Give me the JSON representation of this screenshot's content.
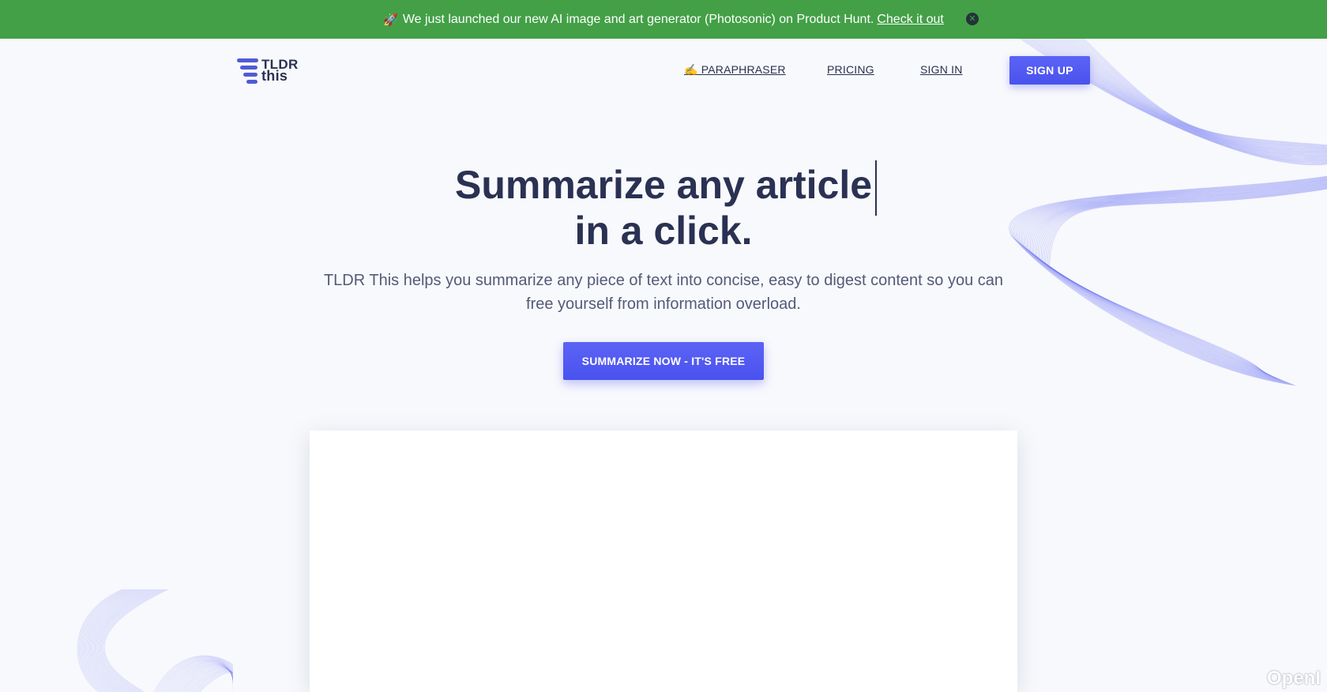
{
  "banner": {
    "icon": "rocket-icon",
    "text": "We just launched our new AI image and art generator (Photosonic) on Product Hunt.",
    "link_label": "Check it out",
    "close_icon": "close-icon",
    "background_color": "#43a047"
  },
  "header": {
    "logo": {
      "line1": "TLDR",
      "line2": "this"
    },
    "nav": [
      {
        "label": "✍️ PARAPHRASER"
      },
      {
        "label": "PRICING"
      },
      {
        "label": "SIGN IN"
      }
    ],
    "signup_label": "SIGN UP"
  },
  "hero": {
    "title_line1": "Summarize any article",
    "title_line2": "in a click.",
    "subtitle": "TLDR This helps you summarize any piece of text into concise, easy to digest content so you can free yourself from information overload.",
    "cta_label": "SUMMARIZE NOW - IT'S FREE"
  },
  "watermark": "OpenI",
  "colors": {
    "accent": "#4f57f0",
    "heading": "#2a3152",
    "body_text": "#545a78",
    "page_background": "#f8f9fc"
  }
}
